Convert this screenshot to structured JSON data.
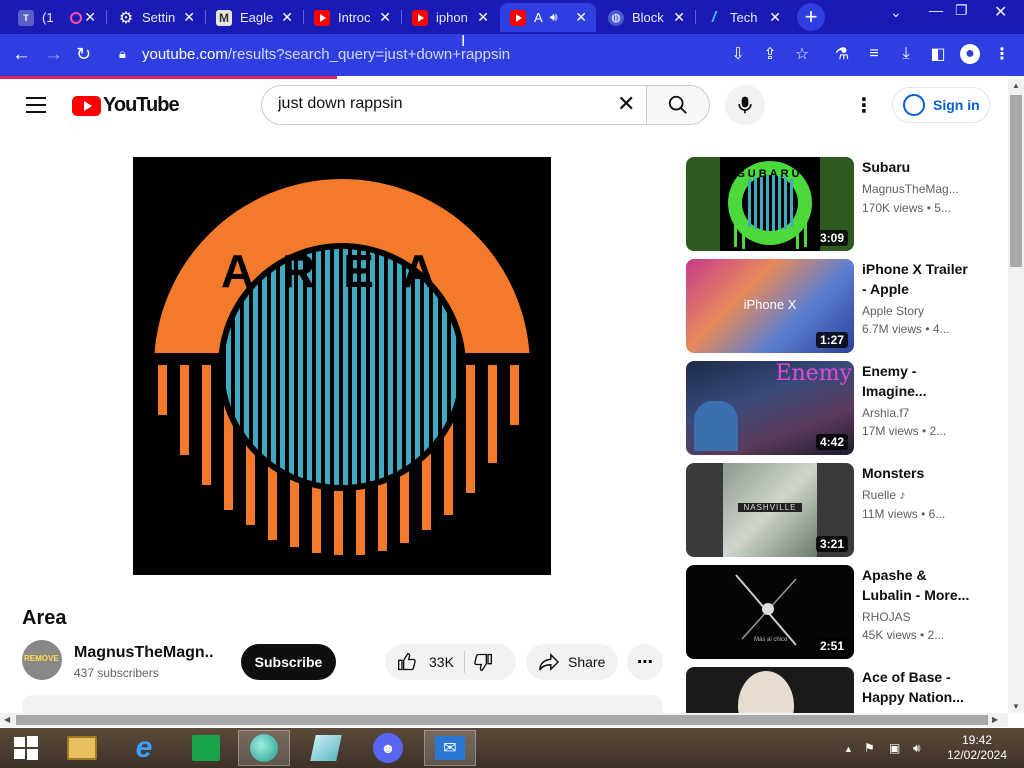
{
  "browser": {
    "tabs": [
      {
        "title": "(1",
        "favicon": "teams-icon",
        "active": false
      },
      {
        "title": "Settin",
        "favicon": "gear-icon",
        "active": false
      },
      {
        "title": "Eagle",
        "favicon": "gmail-icon",
        "active": false
      },
      {
        "title": "Introc",
        "favicon": "youtube-icon",
        "active": false
      },
      {
        "title": "iphon",
        "favicon": "youtube-icon",
        "active": false
      },
      {
        "title": "A",
        "favicon": "youtube-icon",
        "active": true
      },
      {
        "title": "Block",
        "favicon": "globe-icon",
        "active": false
      },
      {
        "title": "Tech",
        "favicon": "tech-icon",
        "active": false
      }
    ],
    "url_host": "youtube.com",
    "url_path": "/results?search_query=just+down+rappsin"
  },
  "youtube": {
    "logo_text": "YouTube",
    "search_value": "just down rappsin",
    "sign_in": "Sign in"
  },
  "video": {
    "title": "Area",
    "thumbnail_text": "AREA",
    "channel": "MagnusTheMagn...",
    "channel_avatar_text": "REMOVE",
    "subscribers": "437 subscribers",
    "subscribe": "Subscribe",
    "likes": "33K",
    "share": "Share"
  },
  "related": [
    {
      "title": "Subaru",
      "channel": "MagnusTheMag...",
      "meta": "170K views  • 5...",
      "duration": "3:09",
      "thumb_text": "SUBARU"
    },
    {
      "title": "iPhone X Trailer - Apple",
      "channel": "Apple Story",
      "meta": "6.7M views  • 4...",
      "duration": "1:27",
      "thumb_text": "iPhone X"
    },
    {
      "title": "Enemy - Imagine...",
      "channel": "Arshia.f7",
      "meta": "17M views  • 2...",
      "duration": "4:42",
      "thumb_text": "Enemy"
    },
    {
      "title": "Monsters",
      "channel": "Ruelle",
      "meta": "11M views  • 6...",
      "duration": "3:21",
      "thumb_text": "NASHVILLE"
    },
    {
      "title": "Apashe & Lubalin - More...",
      "channel": "RHOJAS",
      "meta": "45K views  • 2...",
      "duration": "2:51",
      "thumb_text": "Más al chico"
    },
    {
      "title": "Ace of Base - Happy Nation...",
      "channel": "",
      "meta": "",
      "duration": "",
      "thumb_text": ""
    }
  ],
  "taskbar": {
    "time": "19:42",
    "date": "12/02/2024"
  },
  "colors": {
    "chrome_tabstrip": "#1a1ab4",
    "chrome_toolbar": "#2f3ee0",
    "youtube_red": "#ff0000",
    "link_blue": "#065fd4",
    "area_orange": "#f27a2a",
    "area_teal": "#3fa8c2"
  }
}
